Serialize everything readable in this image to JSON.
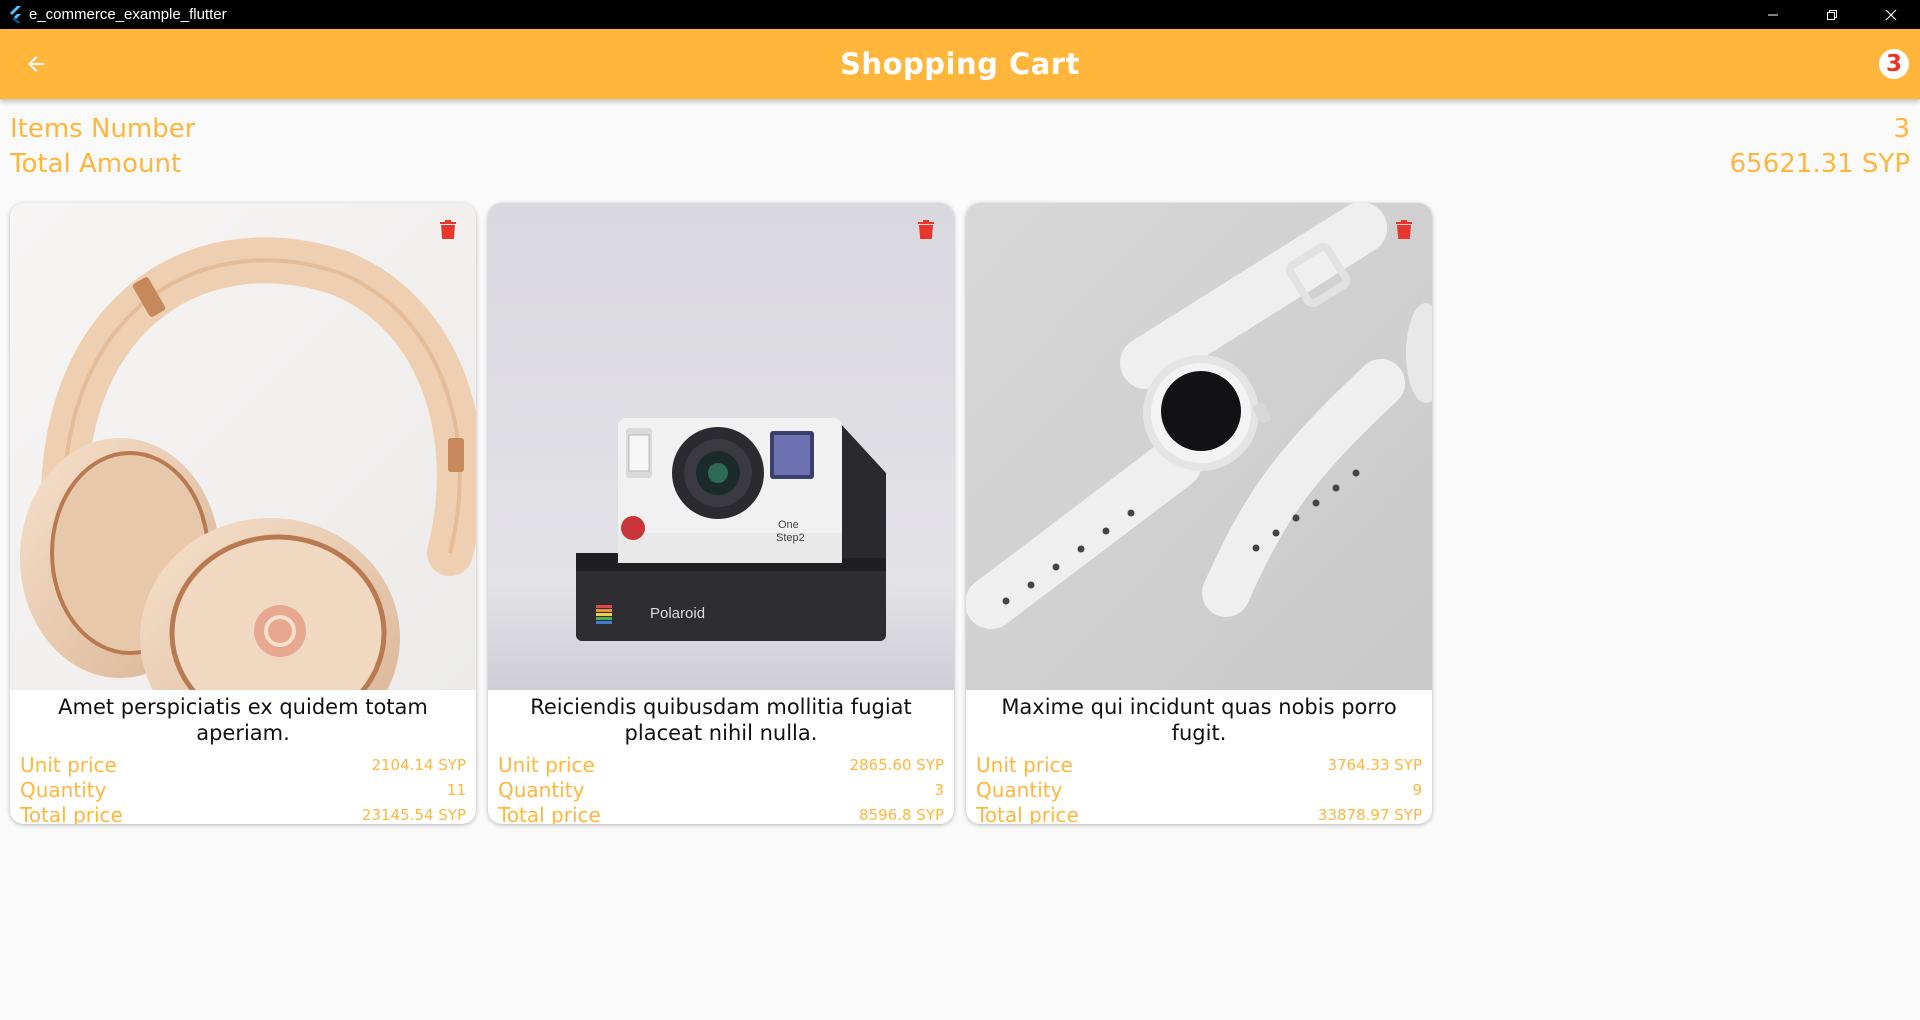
{
  "window": {
    "title": "e_commerce_example_flutter"
  },
  "appbar": {
    "title": "Shopping Cart",
    "badge_count": "3"
  },
  "summary": {
    "items_label": "Items Number",
    "items_value": "3",
    "total_label": "Total Amount",
    "total_value": "65621.31 SYP"
  },
  "labels": {
    "unit_price": "Unit price",
    "quantity": "Quantity",
    "total_price": "Total price"
  },
  "cart": [
    {
      "name": "Amet perspiciatis ex quidem totam aperiam.",
      "unit_price": "2104.14 SYP",
      "quantity": "11",
      "total_price": "23145.54 SYP",
      "image": "headphones"
    },
    {
      "name": "Reiciendis quibusdam mollitia fugiat placeat nihil nulla.",
      "unit_price": "2865.60 SYP",
      "quantity": "3",
      "total_price": "8596.8 SYP",
      "image": "polaroid-camera"
    },
    {
      "name": "Maxime qui incidunt quas nobis porro fugit.",
      "unit_price": "3764.33 SYP",
      "quantity": "9",
      "total_price": "33878.97 SYP",
      "image": "smartwatch"
    }
  ],
  "colors": {
    "accent": "#ffb63b",
    "delete": "#e8362f",
    "background": "#fafafa"
  }
}
